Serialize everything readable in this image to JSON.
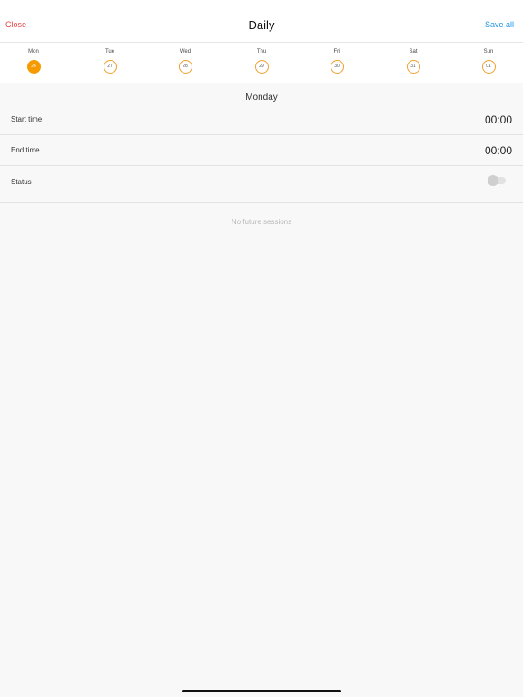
{
  "header": {
    "close_label": "Close",
    "title": "Daily",
    "save_label": "Save all"
  },
  "week": {
    "days": [
      {
        "label": "Mon",
        "date": "26",
        "selected": true
      },
      {
        "label": "Tue",
        "date": "27",
        "selected": false
      },
      {
        "label": "Wed",
        "date": "28",
        "selected": false
      },
      {
        "label": "Thu",
        "date": "29",
        "selected": false
      },
      {
        "label": "Fri",
        "date": "30",
        "selected": false
      },
      {
        "label": "Sat",
        "date": "31",
        "selected": false
      },
      {
        "label": "Sun",
        "date": "01",
        "selected": false
      }
    ]
  },
  "selected_day": {
    "heading": "Monday",
    "start_label": "Start time",
    "start_value": "00:00",
    "end_label": "End time",
    "end_value": "00:00",
    "status_label": "Status",
    "status_on": false
  },
  "empty_note": "No future sessions",
  "colors": {
    "accent_selected": "#f59a00",
    "close": "#e64545",
    "save": "#2196e8"
  }
}
